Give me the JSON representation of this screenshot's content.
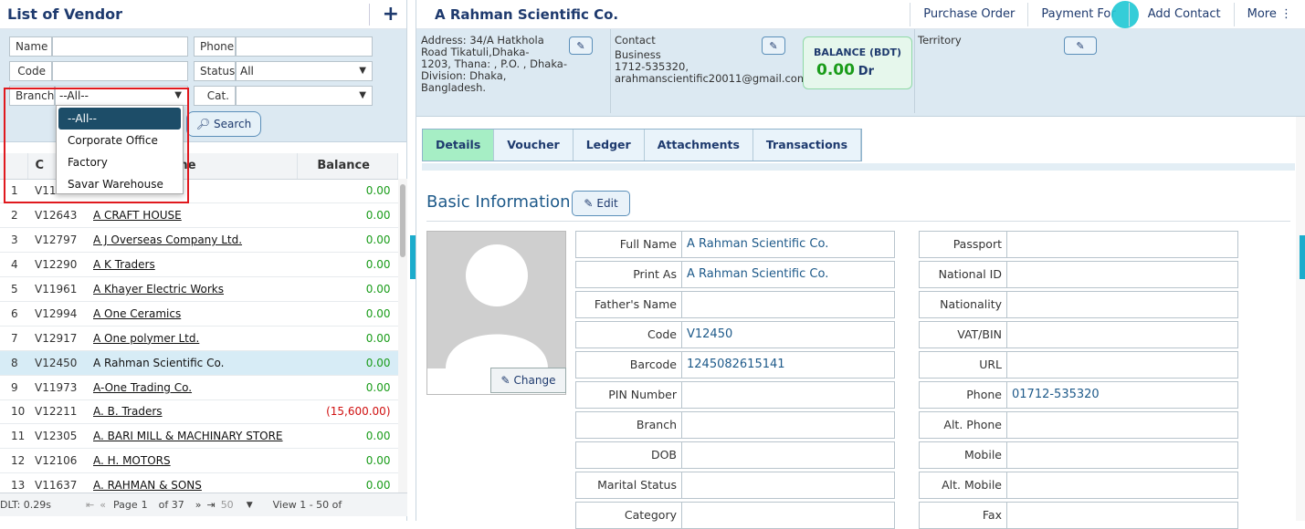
{
  "left_panel": {
    "title": "List of Vendor",
    "add_icon": "plus-icon",
    "filters": {
      "name_label": "Name",
      "name_value": "",
      "phone_label": "Phone",
      "phone_value": "",
      "code_label": "Code",
      "code_value": "",
      "status_label": "Status",
      "status_value": "All",
      "branch_label": "Branch",
      "branch_value": "--All--",
      "cat_label": "Cat.",
      "cat_value": "",
      "search_label": "Search"
    },
    "branch_dropdown": {
      "options": [
        "--All--",
        "Corporate Office",
        "Factory",
        "Savar Warehouse"
      ],
      "selected": "--All--"
    },
    "table": {
      "headers": [
        "",
        "C",
        "Name",
        "Balance"
      ],
      "rows": [
        {
          "num": "1",
          "code": "V11",
          "name": "",
          "balance": "0.00",
          "link": false
        },
        {
          "num": "2",
          "code": "V12643",
          "name": "A CRAFT HOUSE",
          "balance": "0.00",
          "link": true
        },
        {
          "num": "3",
          "code": "V12797",
          "name": "A J Overseas Company Ltd.",
          "balance": "0.00",
          "link": true
        },
        {
          "num": "4",
          "code": "V12290",
          "name": "A K Traders",
          "balance": "0.00",
          "link": true
        },
        {
          "num": "5",
          "code": "V11961",
          "name": "A Khayer Electric Works",
          "balance": "0.00",
          "link": true
        },
        {
          "num": "6",
          "code": "V12994",
          "name": "A One Ceramics",
          "balance": "0.00",
          "link": true
        },
        {
          "num": "7",
          "code": "V12917",
          "name": "A One polymer Ltd.",
          "balance": "0.00",
          "link": true
        },
        {
          "num": "8",
          "code": "V12450",
          "name": "A Rahman Scientific Co.",
          "balance": "0.00",
          "link": false,
          "selected": true
        },
        {
          "num": "9",
          "code": "V11973",
          "name": "A-One Trading Co.",
          "balance": "0.00",
          "link": true
        },
        {
          "num": "10",
          "code": "V12211",
          "name": "A. B. Traders",
          "balance": "(15,600.00)",
          "link": true,
          "negative": true
        },
        {
          "num": "11",
          "code": "V12305",
          "name": "A. BARI MILL & MACHINARY STORE",
          "balance": "0.00",
          "link": true
        },
        {
          "num": "12",
          "code": "V12106",
          "name": "A. H. MOTORS",
          "balance": "0.00",
          "link": true
        },
        {
          "num": "13",
          "code": "V11637",
          "name": "A. RAHMAN & SONS",
          "balance": "0.00",
          "link": true
        }
      ]
    },
    "pager": {
      "dlt": "DLT: 0.29s",
      "page_label": "Page",
      "page": "1",
      "of": "of 37",
      "page_size": "50",
      "view": "View 1 - 50 of"
    }
  },
  "right_panel": {
    "title": "A Rahman Scientific Co.",
    "links": [
      "Purchase Order",
      "Payment For",
      "Add Contact",
      "More"
    ],
    "address": "Address: 34/A Hatkhola Road Tikatuli,Dhaka-1203, Thana: , P.O. , Dhaka-Division: Dhaka, Bangladesh.",
    "address_lines": [
      "Address: 34/A Hatkhola",
      "Road Tikatuli,Dhaka-",
      "1203, Thana: , P.O. , Dhaka-",
      "Division: Dhaka, Bangladesh."
    ],
    "contact_label": "Contact",
    "contact_lines": [
      "Business",
      "1712-535320,",
      "arahmanscientific20011@gmail.com"
    ],
    "balance_label": "BALANCE (BDT)",
    "balance_value": "0.00",
    "balance_suffix": "Dr",
    "territory_label": "Territory",
    "tabs": [
      "Details",
      "Voucher",
      "Ledger",
      "Attachments",
      "Transactions"
    ],
    "active_tab": "Details",
    "section_title": "Basic Information",
    "edit_label": "Edit",
    "change_label": "Change",
    "fields_left": [
      {
        "label": "Full Name",
        "value": "A Rahman Scientific Co."
      },
      {
        "label": "Print As",
        "value": "A Rahman Scientific Co."
      },
      {
        "label": "Father's Name",
        "value": ""
      },
      {
        "label": "Code",
        "value": "V12450"
      },
      {
        "label": "Barcode",
        "value": "1245082615141"
      },
      {
        "label": "PIN Number",
        "value": ""
      },
      {
        "label": "Branch",
        "value": ""
      },
      {
        "label": "DOB",
        "value": ""
      },
      {
        "label": "Marital Status",
        "value": ""
      },
      {
        "label": "Category",
        "value": ""
      }
    ],
    "fields_right": [
      {
        "label": "Passport",
        "value": ""
      },
      {
        "label": "National ID",
        "value": ""
      },
      {
        "label": "Nationality",
        "value": ""
      },
      {
        "label": "VAT/BIN",
        "value": ""
      },
      {
        "label": "URL",
        "value": ""
      },
      {
        "label": "Phone",
        "value": "01712-535320"
      },
      {
        "label": "Alt. Phone",
        "value": ""
      },
      {
        "label": "Mobile",
        "value": ""
      },
      {
        "label": "Alt. Mobile",
        "value": ""
      },
      {
        "label": "Fax",
        "value": ""
      }
    ]
  },
  "colors": {
    "brand_navy": "#1e3a6e",
    "filter_bg": "#dce9f2",
    "positive": "#1a9c1a",
    "negative": "#d01010",
    "active_tab": "#a6eec5",
    "highlight_box": "#e0191e"
  }
}
